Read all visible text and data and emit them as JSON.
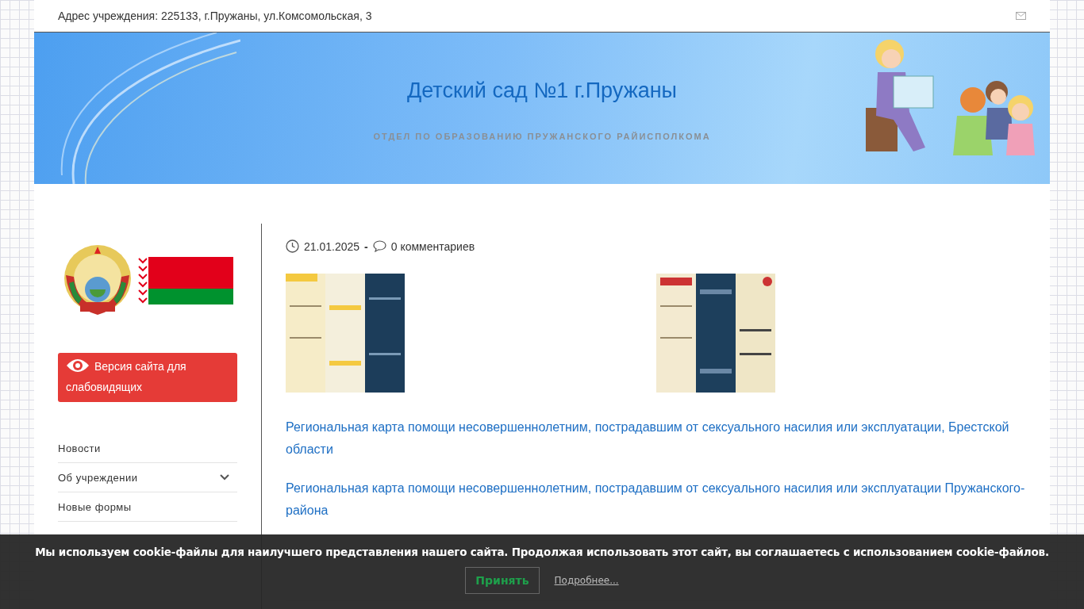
{
  "top_bar": {
    "address": "Адрес учреждения: 225133, г.Пружаны, ул.Комсомольская, 3"
  },
  "header": {
    "title": "Детский сад №1 г.Пружаны",
    "subtitle": "ОТДЕЛ ПО ОБРАЗОВАНИЮ ПРУЖАНСКОГО РАЙИСПОЛКОМА"
  },
  "sidebar": {
    "accessibility_button": "Версия сайта для слабовидящих",
    "menu": [
      {
        "label": "Новости",
        "expandable": false
      },
      {
        "label": "Об учреждении",
        "expandable": true
      },
      {
        "label": "Новые формы",
        "expandable": false
      }
    ]
  },
  "post": {
    "date": "21.01.2025",
    "separator": "-",
    "comments": "0 комментариев",
    "images": [
      {
        "kind": "picture"
      },
      {
        "kind": "picture"
      }
    ],
    "links": [
      "Региональная карта помощи несовершеннолетним, пострадавшим от сексуального насилия или эксплуатации, Брестской области",
      "Региональная карта помощи несовершеннолетним, пострадавшим от сексуального насилия или эксплуатации Пружанского-района"
    ]
  },
  "cookie_banner": {
    "text": "Мы используем cookie-файлы для наилучшего представления нашего сайта. Продолжая использовать этот сайт, вы соглашаетесь с использованием cookie-файлов.",
    "accept": "Принять",
    "more": "Подробнее..."
  }
}
